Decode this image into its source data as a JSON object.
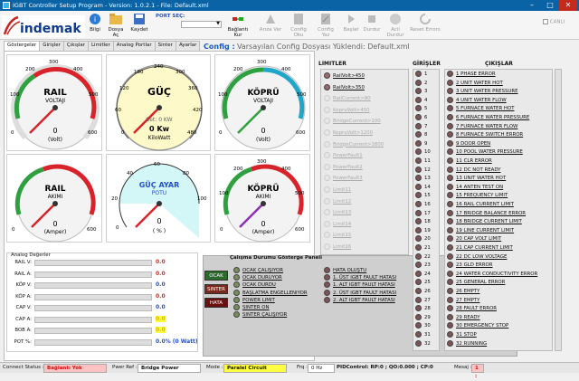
{
  "title": "IGBT Controller Setup Program  -  Version: 1.0.2.1  -  File: Default.xml",
  "toolbar": {
    "bilgi": "Bilgi",
    "dosya_ac": "Dosya Aç",
    "kaydet": "Kaydet",
    "port_label": "PORT SEÇ:",
    "baglanti": "Bağlantı Kur",
    "arizi": "Arıza Ver",
    "config_oku": "Config Oku",
    "config_yaz": "Config Yaz",
    "baslat": "Başlat",
    "durdur": "Durdur",
    "acil": "Acil Durdur",
    "reset": "Reset Errors",
    "canli": "CANLI"
  },
  "logo": {
    "text": "indemak"
  },
  "tabs": [
    "Göstergeler",
    "Girişler",
    "Çıkışlar",
    "Limitler",
    "Analog Portlar",
    "Sinter",
    "Ayarlar"
  ],
  "config": {
    "label": "Config :",
    "value": "Varsayılan Config Dosyası Yüklendi: Default.xml"
  },
  "gauges": {
    "rail_v": {
      "title1": "RAIL",
      "title2": "VOLTAJI",
      "value": "0",
      "unit": "(Volt)",
      "ticks": [
        "0",
        "100",
        "200",
        "300",
        "400",
        "500",
        "600"
      ]
    },
    "guc": {
      "title": "GÜÇ",
      "set": "Set: 0 KW",
      "value": "0 Kw",
      "unit": "KiloWatt",
      "ticks": [
        "0",
        "60",
        "120",
        "180",
        "240",
        "300",
        "360",
        "420",
        "480"
      ]
    },
    "kopru_v": {
      "title1": "KÖPRÜ",
      "title2": "VOLTAJI",
      "value": "0",
      "unit": "(Volt)",
      "ticks": [
        "0",
        "100",
        "200",
        "300",
        "400",
        "500",
        "600"
      ]
    },
    "rail_a": {
      "title1": "RAIL",
      "title2": "AKIMI",
      "value": "0",
      "unit": "(Amper)",
      "ticks": [
        "0",
        "600"
      ]
    },
    "guc_ayar": {
      "title1": "GÜÇ AYAR",
      "title2": "POTU",
      "value": "0",
      "unit": "( % )",
      "ticks": [
        "0",
        "20",
        "40",
        "60",
        "80",
        "100"
      ]
    },
    "kopru_a": {
      "title1": "KÖPRÜ",
      "title2": "AKIMI",
      "value": "0",
      "unit": "(Amper)",
      "ticks": [
        "0",
        "100",
        "200",
        "300",
        "400",
        "500",
        "600"
      ]
    }
  },
  "analog": {
    "header": "Analog Değerler",
    "rows": [
      {
        "label": "RAIL V:",
        "value": "0.0",
        "color": "#e02020"
      },
      {
        "label": "RAIL A:",
        "value": "0.0",
        "color": "#e02020"
      },
      {
        "label": "KÖP V:",
        "value": "0.0",
        "color": "#2050d0"
      },
      {
        "label": "KÖP A:",
        "value": "0.0",
        "color": "#e02020"
      },
      {
        "label": "CAP V:",
        "value": "0.0",
        "color": "#2050d0"
      },
      {
        "label": "CAP A:",
        "value": "0.0",
        "color": "#e0b000"
      },
      {
        "label": "BOB A:",
        "value": "0.0",
        "color": "#e0b000"
      },
      {
        "label": "POT %:",
        "value": "0.0% (0 Watt)",
        "color": "#2050d0"
      }
    ]
  },
  "calisma": {
    "header": "Çalışma Durumu Gösterge Paneli",
    "buttons": [
      "OCAK",
      "SINTER",
      "HATA"
    ],
    "col1": [
      "OCAK ÇALIŞIYOR",
      "OCAK DURUYOR",
      "OCAK DURDU",
      "BAŞLATMA ENGELLENIYOR",
      "POWER LIMIT",
      "SINTER ON",
      "SINTER ÇALIŞIYOR"
    ],
    "col2": [
      "HATA OLUŞTU",
      "1. ÜST IGBT FAULT HATASI",
      "1. ALT IGBT FAULT HATASI",
      "2. ÜST IGBT FAULT HATASI",
      "2. ALT IGBT FAULT HATASI"
    ]
  },
  "limitler": {
    "header": "LIMITLER",
    "items": [
      "RailVolt>450",
      "RailVolt>350",
      "RailCurrent>80",
      "KopruVolt>450",
      "BridgeCurrent>100",
      "KopruVolt>1200",
      "BridgeCurrent>1800",
      "PowerFault1",
      "PowerFault2",
      "PowerFault3",
      "Limit11",
      "Limit12",
      "Limit13",
      "Limit14",
      "Limit15",
      "Limit16"
    ]
  },
  "girisler": {
    "header": "GİRİŞLER",
    "items": [
      "1",
      "2",
      "3",
      "4",
      "5",
      "6",
      "7",
      "8",
      "9",
      "10",
      "11",
      "12",
      "13",
      "14",
      "15",
      "16",
      "17",
      "18",
      "19",
      "20",
      "21",
      "22",
      "23",
      "24",
      "25",
      "26",
      "27",
      "28",
      "29",
      "30",
      "31",
      "32"
    ]
  },
  "cikislar": {
    "header": "ÇIKIŞLAR",
    "items": [
      "1 PHASE ERROR",
      "2 UNIT WATER HOT",
      "3 UNIT WATER PRESSURE",
      "4 UNIT WATER FLOW",
      "5 FURNACE WATER HOT",
      "6 FURNACE WATER PRESSURE",
      "7 FURNACE WATER FLOW",
      "8 FURNACE SWITCH ERROR",
      "9 DOOR OPEN",
      "10 POOL WATER PRESSURE",
      "11 CLR ERROR",
      "12 DC NOT READY",
      "13 UNIT WATER HOT",
      "14 ANTEN TEST ON",
      "15 FREQUENCY LIMIT",
      "16 RAIL CURRENT LIMIT",
      "17 BRIDGE BALANCE ERROR",
      "18 BRIDGE CURRENT LIMIT",
      "19 LINE CURRENT LIMIT",
      "20 CAP VOLT LIMIT",
      "21 CAP CURRENT LIMIT",
      "22 DC LOW VOLTAGE",
      "23 GLD ERROR",
      "24 WATER CONDUCTIVITY ERROR",
      "25 GENERAL ERROR",
      "26 EMPTY",
      "27 EMPTY",
      "28 FAULT ERROR",
      "29 READY",
      "30 EMERGENCY STOP",
      "31 STOP",
      "32 RUNNING"
    ]
  },
  "status": {
    "connect_label": "Connect Status :",
    "connect_value": "Bağlantı Yok",
    "pwr_label": "Pwer Ref :",
    "pwr_value": "Bridge Power",
    "mode_label": "Mode :",
    "mode_value": "Paralel Circuit",
    "frq_label": "Frq :",
    "frq_value": "0 Hz",
    "pid_text": "PIDControl: RP:0 ; QO:0.000 ; CP:0",
    "mesaj_label": "Mesaj :",
    "mesaj_value": "1 :"
  }
}
